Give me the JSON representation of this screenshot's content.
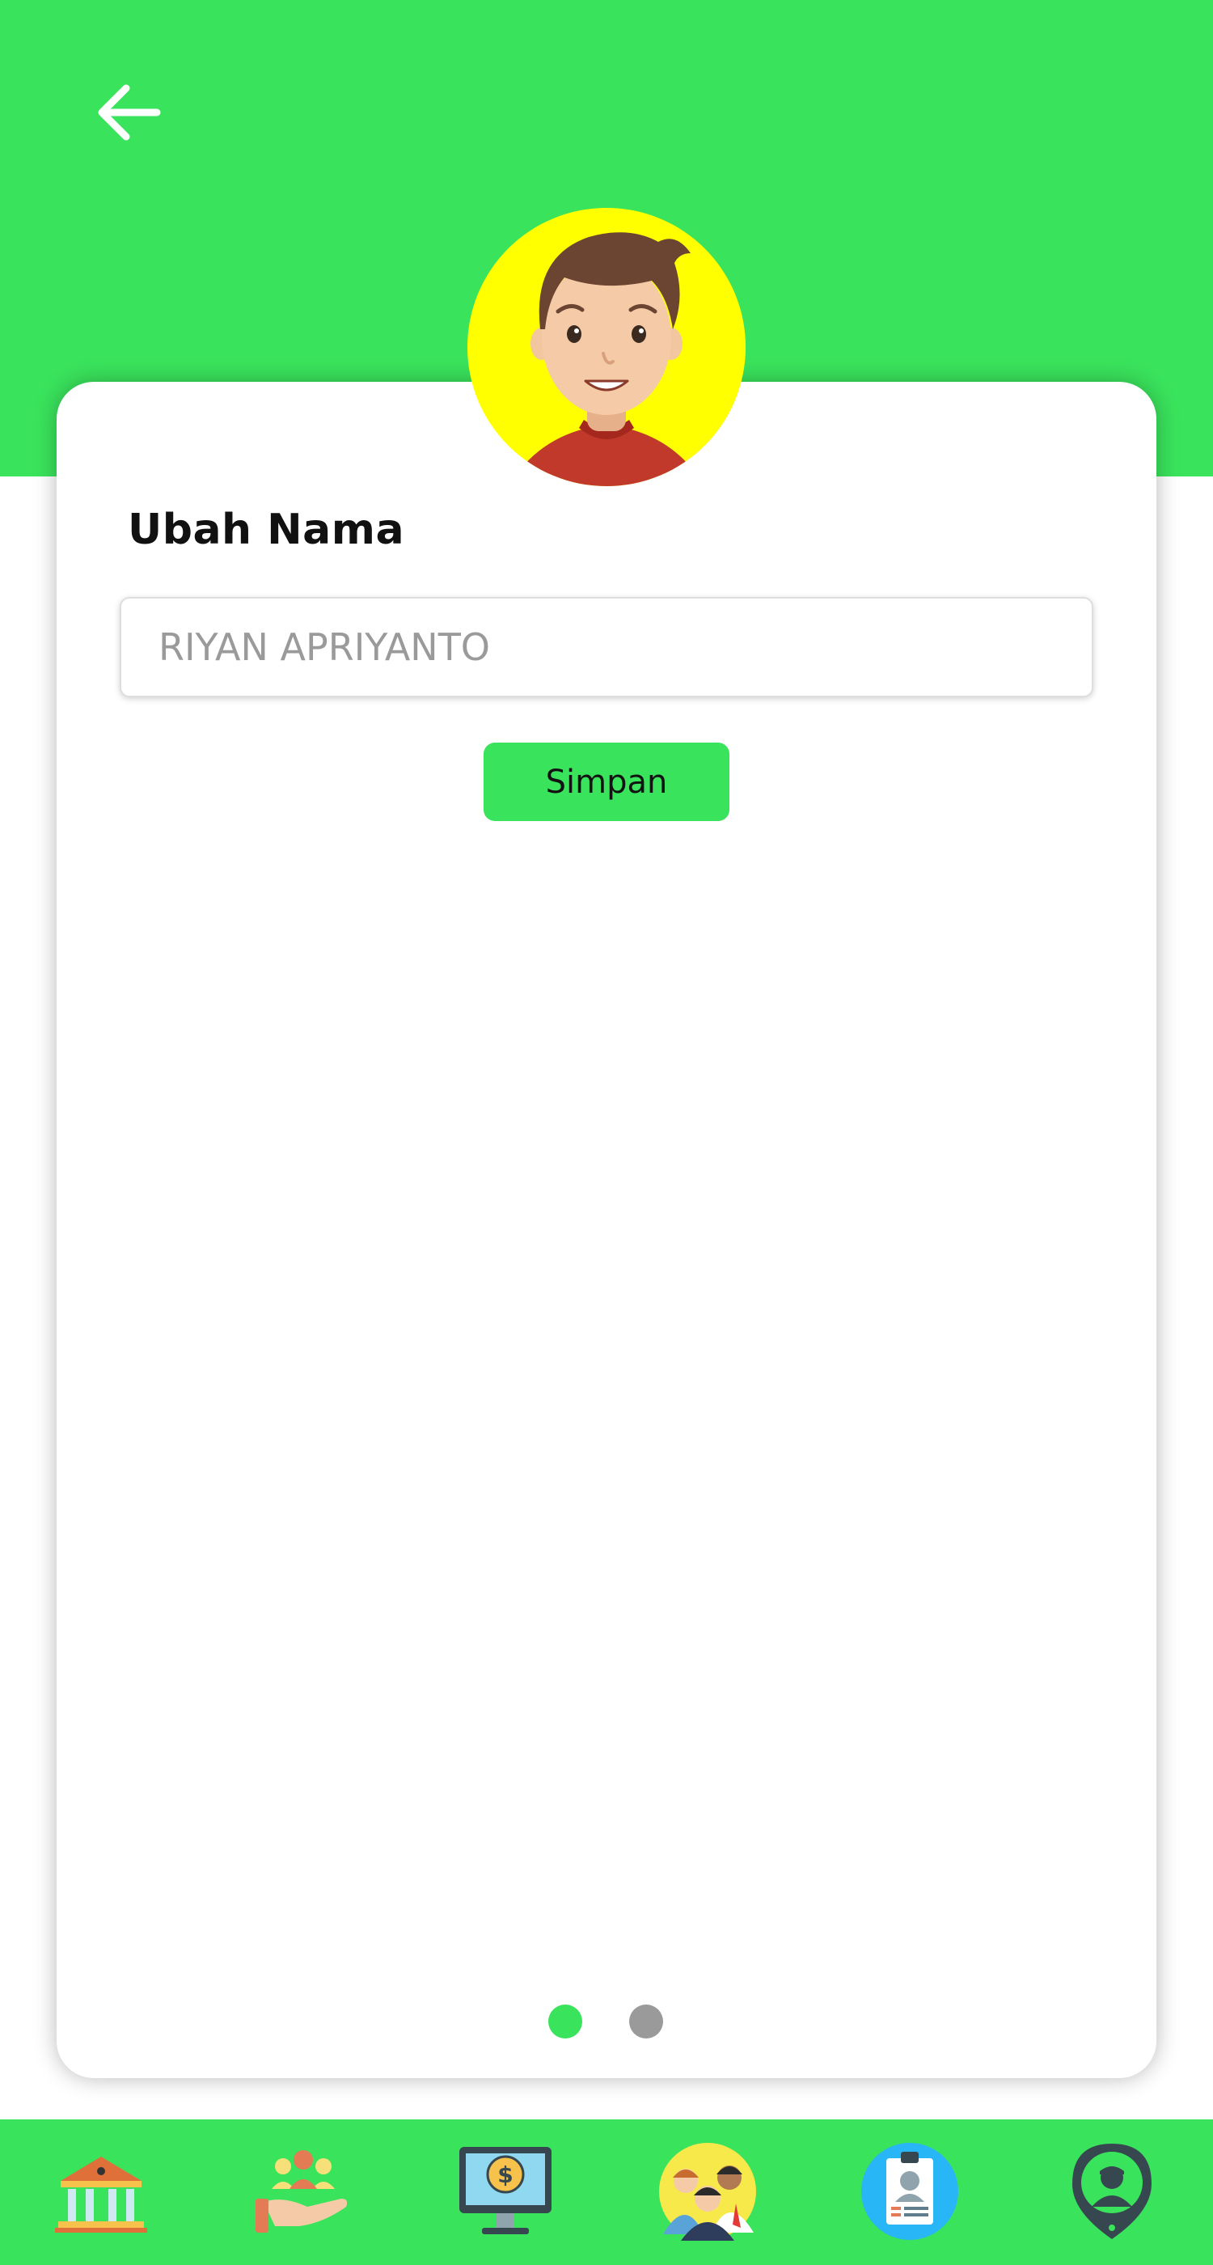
{
  "header": {
    "back_icon": "arrow-left-icon"
  },
  "profile": {
    "avatar_icon": "user-avatar-icon"
  },
  "form": {
    "title": "Ubah Nama",
    "name_placeholder": "RIYAN APRIYANTO",
    "name_value": "",
    "save_label": "Simpan"
  },
  "pager": {
    "dots": [
      {
        "state": "active"
      },
      {
        "state": "inactive"
      }
    ]
  },
  "bottom_nav": {
    "items": [
      {
        "icon": "bank-building-icon"
      },
      {
        "icon": "hand-giving-people-icon"
      },
      {
        "icon": "monitor-dollar-icon"
      },
      {
        "icon": "group-people-icon"
      },
      {
        "icon": "id-card-clipboard-icon"
      },
      {
        "icon": "location-person-pin-icon"
      }
    ]
  },
  "colors": {
    "primary_green": "#3ae35c",
    "avatar_background": "#ffff00",
    "dot_active": "#3ae35c",
    "dot_inactive": "#9a9a9a"
  }
}
